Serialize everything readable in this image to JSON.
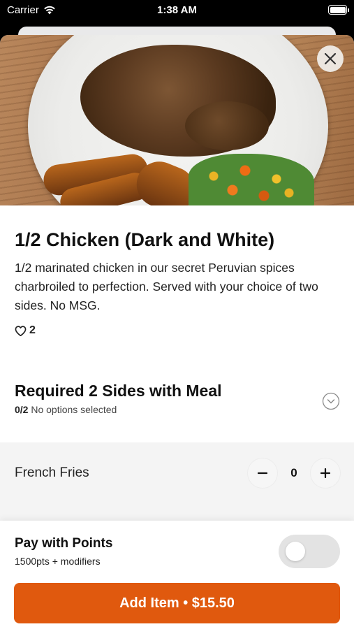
{
  "status_bar": {
    "carrier": "Carrier",
    "time": "1:38 AM"
  },
  "item": {
    "title": "1/2 Chicken (Dark and White)",
    "description": "1/2 marinated chicken in our secret Peruvian spices charbroiled to perfection. Served with your choice of two sides. No MSG.",
    "likes": "2"
  },
  "modifier_group": {
    "title": "Required 2 Sides with Meal",
    "count": "0/2",
    "status": "No options selected"
  },
  "options": [
    {
      "name": "French Fries",
      "quantity": "0"
    }
  ],
  "payment": {
    "title": "Pay with Points",
    "subtitle": "1500pts + modifiers",
    "toggle_on": false
  },
  "cta": {
    "label": "Add Item • $15.50",
    "color": "#e0590e"
  },
  "icons": [
    "wifi-icon",
    "battery-icon",
    "close-icon",
    "heart-icon",
    "chevron-down-icon",
    "minus-icon",
    "plus-icon"
  ]
}
